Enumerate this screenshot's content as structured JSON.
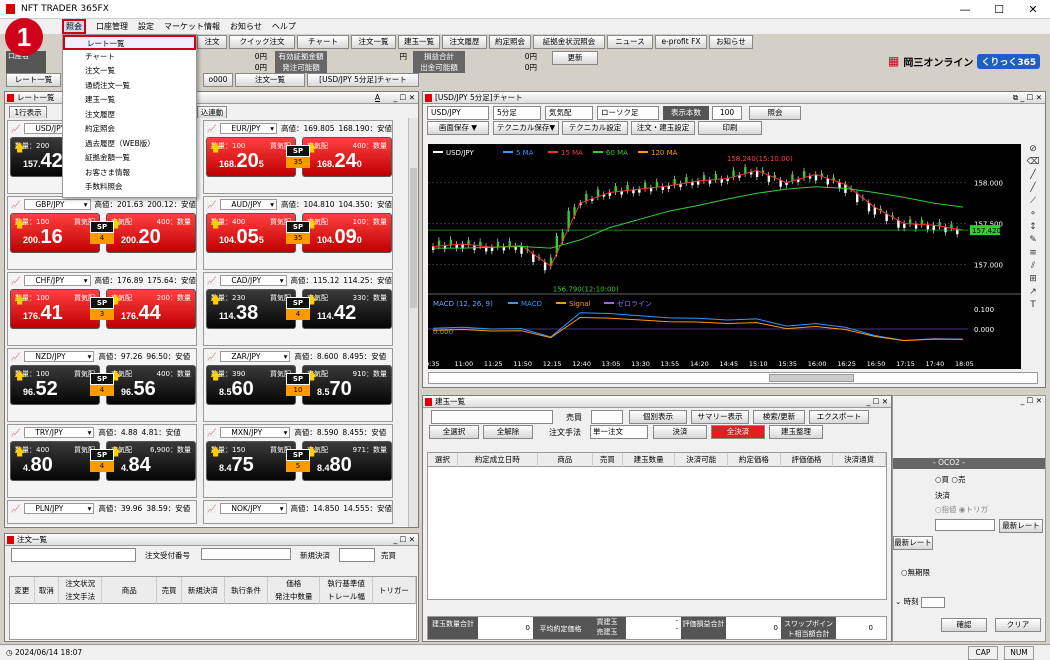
{
  "app": {
    "title": "NFT TRADER 365FX",
    "minimize": "—",
    "maximize": "☐",
    "close": "✕",
    "step_badge": "1"
  },
  "menu": [
    "照会",
    "口座管理",
    "設定",
    "マーケット情報",
    "お知らせ",
    "ヘルプ"
  ],
  "dropdown": [
    "レート一覧",
    "チャート",
    "注文一覧",
    "通続注文一覧",
    "建玉一覧",
    "注文履歴",
    "約定照会",
    "過去履歴（WEB版）",
    "証拠金額一覧",
    "お客さま情報",
    "手数料照会"
  ],
  "toolbar": [
    "注文",
    "クイック注文",
    "チャート",
    "注文一覧",
    "建玉一覧",
    "注文履歴",
    "約定照会",
    "証拠金状況照会",
    "ニュース",
    "e-profit FX",
    "お知らせ"
  ],
  "account": {
    "rows": [
      [
        "0円",
        "有効証拠金額"
      ],
      [
        "0円",
        "発注可能額"
      ]
    ],
    "rows2": [
      [
        "損益合計",
        "0円"
      ],
      [
        "出金可能額",
        "0円"
      ]
    ],
    "update": "更新",
    "partial_left": "口座名"
  },
  "brand": {
    "okasan": "岡三オンライン",
    "kurikku": "くりっく365"
  },
  "doctabs": [
    "レート一覧",
    "o000",
    "注文一覧",
    "[USD/JPY 5分足]チャート"
  ],
  "rate_panel": {
    "title": "レート一覧",
    "btn1": "1行表示",
    "btn2": "込連動",
    "min": "A",
    "ctrl": "_ ☐ ✕"
  },
  "tiles": [
    {
      "pair": "USD/JPY",
      "hi": "",
      "lo": "",
      "qty_bid": "数量：200",
      "bid_label": "",
      "ask_label": "",
      "qty_ask": "",
      "bid_pre": "157.",
      "bid": "42",
      "ask_pre": "",
      "ask": "",
      "sp": "",
      "color": "black",
      "partial": true
    },
    {
      "pair": "EUR/JPY",
      "hi": "高値：169.805",
      "lo": "168.190：安値",
      "qty_bid": "数量：100",
      "bid_label": "買気配",
      "ask_label": "売気配",
      "qty_ask": "400：数量",
      "bid_pre": "168.",
      "bid": "20",
      "bid_small": "5",
      "ask_pre": "168.",
      "ask": "24",
      "ask_small": "0",
      "sp": "35",
      "color": "red"
    },
    {
      "pair": "GBP/JPY",
      "hi": "高値：201.63",
      "lo": "200.12：安値",
      "qty_bid": "数量：100",
      "bid_label": "買気配",
      "ask_label": "売気配",
      "qty_ask": "400：数量",
      "bid_pre": "200.",
      "bid": "16",
      "ask_pre": "200.",
      "ask": "20",
      "sp": "4",
      "color": "red"
    },
    {
      "pair": "AUD/JPY",
      "hi": "高値：104.810",
      "lo": "104.350：安値",
      "qty_bid": "数量：400",
      "bid_label": "買気配",
      "ask_label": "売気配",
      "qty_ask": "100：数量",
      "bid_pre": "104.",
      "bid": "05",
      "bid_small": "5",
      "ask_pre": "104.",
      "ask": "09",
      "ask_small": "0",
      "sp": "35",
      "color": "red"
    },
    {
      "pair": "CHF/JPY",
      "hi": "高値：176.89",
      "lo": "175.64：安値",
      "qty_bid": "数量：100",
      "bid_label": "買気配",
      "ask_label": "売気配",
      "qty_ask": "200：数量",
      "bid_pre": "176.",
      "bid": "41",
      "ask_pre": "176.",
      "ask": "44",
      "sp": "3",
      "color": "red"
    },
    {
      "pair": "CAD/JPY",
      "hi": "高値：115.12",
      "lo": "114.25：安値",
      "qty_bid": "数量：230",
      "bid_label": "買気配",
      "ask_label": "売気配",
      "qty_ask": "330：数量",
      "bid_pre": "114.",
      "bid": "38",
      "ask_pre": "114.",
      "ask": "42",
      "sp": "4",
      "color": "black"
    },
    {
      "pair": "NZD/JPY",
      "hi": "高値：97.26",
      "lo": "96.50：安値",
      "qty_bid": "数量：100",
      "bid_label": "買気配",
      "ask_label": "売気配",
      "qty_ask": "400：数量",
      "bid_pre": "96.",
      "bid": "52",
      "ask_pre": "96.",
      "ask": "56",
      "sp": "4",
      "color": "black"
    },
    {
      "pair": "ZAR/JPY",
      "hi": "高値：8.600",
      "lo": "8.495：安値",
      "qty_bid": "数量：390",
      "bid_label": "買気配",
      "ask_label": "売気配",
      "qty_ask": "910：数量",
      "bid_pre": "8.5",
      "bid": "60",
      "ask_pre": "8.5",
      "ask": "70",
      "sp": "10",
      "color": "black"
    },
    {
      "pair": "TRY/JPY",
      "hi": "高値：4.88",
      "lo": "4.81：安値",
      "qty_bid": "数量：400",
      "bid_label": "買気配",
      "ask_label": "売気配",
      "qty_ask": "6,900：数量",
      "bid_pre": "4.",
      "bid": "80",
      "ask_pre": "4.",
      "ask": "84",
      "sp": "4",
      "color": "black"
    },
    {
      "pair": "MXN/JPY",
      "hi": "高値：8.590",
      "lo": "8.455：安値",
      "qty_bid": "数量：150",
      "bid_label": "買気配",
      "ask_label": "売気配",
      "qty_ask": "971：数量",
      "bid_pre": "8.4",
      "bid": "75",
      "ask_pre": "8.4",
      "ask": "80",
      "sp": "5",
      "color": "black"
    }
  ],
  "tiles_partial": [
    {
      "pair": "PLN/JPY",
      "hi": "高値：39.96",
      "lo": "38.59：安値"
    },
    {
      "pair": "NOK/JPY",
      "hi": "高値：14.850",
      "lo": "14.555：安値"
    }
  ],
  "sp_label": "SP",
  "chart": {
    "title": "[USD/JPY 5分足]チャート",
    "pair": "USD/JPY",
    "interval": "5分足",
    "quote": "気気配",
    "kind": "ローソク足",
    "count_label": "表示本数",
    "count": "100",
    "query": "照会",
    "b1": "画面保存 ▼",
    "b2": "テクニカル保存▼",
    "b3": "テクニカル設定",
    "b4": "注文・建玉設定",
    "b5": "印刷",
    "legend": [
      "USD/JPY",
      "5 MA",
      "15 MA",
      "60 MA",
      "120 MA"
    ],
    "legend_colors": [
      "#ffffff",
      "#3399ff",
      "#ff3333",
      "#33cc33",
      "#ff9900"
    ],
    "high_label": "158.240(15:10:00)",
    "low_label": "156.790(12:10:00)",
    "yticks": [
      "158.000",
      "157.500",
      "157.000"
    ],
    "last": "157.420",
    "macd_label": "MACD (12, 26, 9)",
    "macd_legend": [
      "MACD",
      "Signal",
      "ゼロライン"
    ],
    "macd_colors": [
      "#3399ff",
      "#ff9900",
      "#9966ff"
    ],
    "macd_zero": "0.000",
    "macd_ticks": [
      "0.100",
      "0.000"
    ],
    "xticks": [
      "0:35",
      "11:00",
      "11:25",
      "11:50",
      "12:15",
      "12:40",
      "13:05",
      "13:30",
      "13:55",
      "14:20",
      "14:45",
      "15:10",
      "15:35",
      "16:00",
      "16:25",
      "16:50",
      "17:15",
      "17:40",
      "18:05"
    ]
  },
  "chart_data": {
    "type": "line",
    "title": "",
    "pair": "USD/JPY",
    "x": [
      "0:35",
      "11:00",
      "11:25",
      "11:50",
      "12:15",
      "12:40",
      "13:05",
      "13:30",
      "13:55",
      "14:20",
      "14:45",
      "15:10",
      "15:35",
      "16:00",
      "16:25",
      "16:50",
      "17:15",
      "17:40",
      "18:05"
    ],
    "series": [
      {
        "name": "USD/JPY",
        "values": [
          157.22,
          157.25,
          157.21,
          157.23,
          156.98,
          157.75,
          157.88,
          157.92,
          157.96,
          158.02,
          158.05,
          158.15,
          158.0,
          158.1,
          157.98,
          157.7,
          157.5,
          157.48,
          157.42
        ]
      },
      {
        "name": "60 MA",
        "values": [
          157.2,
          157.2,
          157.21,
          157.22,
          157.2,
          157.3,
          157.45,
          157.55,
          157.65,
          157.72,
          157.8,
          157.87,
          157.92,
          157.95,
          157.93,
          157.88,
          157.82,
          157.75,
          157.7
        ]
      }
    ],
    "ylim": [
      156.7,
      158.35
    ]
  },
  "positions": {
    "title": "建玉一覧",
    "side": "売買",
    "b1": "個別表示",
    "b2": "サマリー表示",
    "b3": "検索/更新",
    "b4": "エクスポート",
    "sel_all": "全選択",
    "clear_all": "全解除",
    "method_label": "注文手法",
    "method": "単一注文",
    "settle": "決済",
    "all_settle": "全決済",
    "arrange": "建玉整理",
    "cols": [
      "選択",
      "約定成立日時",
      "商品",
      "売買",
      "建玉数量",
      "決済可能",
      "約定価格",
      "評価価格",
      "決済通貨"
    ],
    "footer": [
      "建玉数量合計",
      "0",
      "平均約定価格",
      "買建玉",
      "-",
      "売建玉",
      "-",
      "評価損益合計",
      "0",
      "スワップポイント相当額合計",
      "0"
    ]
  },
  "orders": {
    "title": "注文一覧",
    "l1": "注文受付番号",
    "l2": "新規決済",
    "l3": "売買",
    "cols": [
      "変更",
      "取消",
      "注文状況",
      "商品",
      "売買",
      "新規決済",
      "執行条件",
      "価格",
      "執行基準値",
      "トリガー"
    ],
    "cols2": [
      "注文手法",
      "発注中数量",
      "トレール幅"
    ]
  },
  "order_form": {
    "oco": "- OCO2 -",
    "buy": "買",
    "sell": "売",
    "settle": "決済",
    "limit": "指値",
    "trigger": "トリガ",
    "latest": "最新レート",
    "indef": "無期限",
    "time": "時刻",
    "confirm": "確認",
    "clear": "クリア"
  },
  "status": {
    "date": "2024/06/14 18:07",
    "cap": "CAP",
    "num": "NUM"
  }
}
